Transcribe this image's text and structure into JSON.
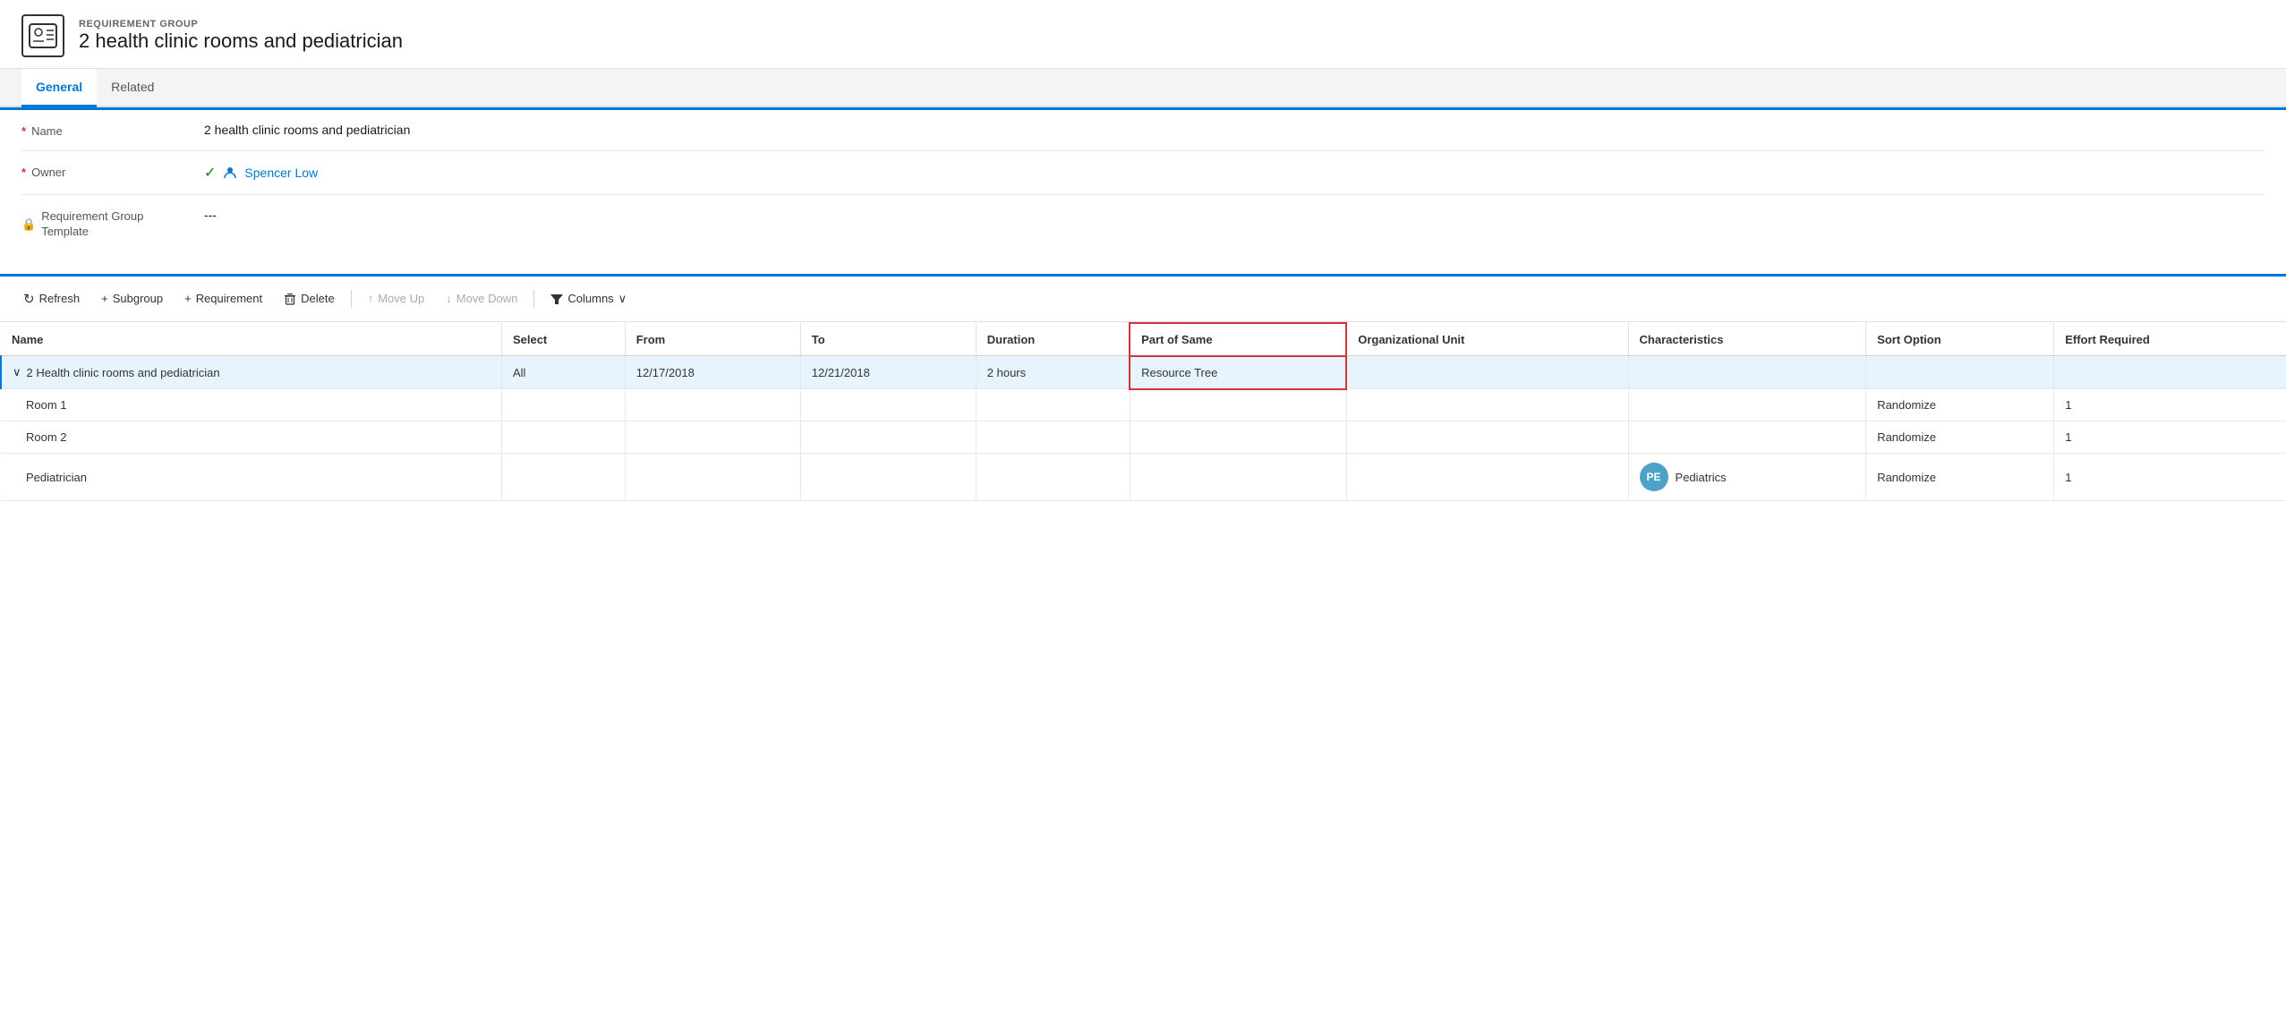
{
  "header": {
    "entity_type": "REQUIREMENT GROUP",
    "title": "2 health clinic rooms and pediatrician"
  },
  "tabs": [
    {
      "id": "general",
      "label": "General",
      "active": true
    },
    {
      "id": "related",
      "label": "Related",
      "active": false
    }
  ],
  "form": {
    "fields": [
      {
        "id": "name",
        "label": "Name",
        "required": true,
        "value": "2 health clinic rooms and pediatrician",
        "type": "text"
      },
      {
        "id": "owner",
        "label": "Owner",
        "required": true,
        "value": "Spencer Low",
        "type": "owner"
      },
      {
        "id": "requirement_group_template",
        "label": "Requirement Group Template",
        "required": false,
        "value": "---",
        "type": "text",
        "has_lock": true
      }
    ]
  },
  "toolbar": {
    "buttons": [
      {
        "id": "refresh",
        "label": "Refresh",
        "icon": "↻",
        "disabled": false
      },
      {
        "id": "subgroup",
        "label": "Subgroup",
        "icon": "+",
        "disabled": false
      },
      {
        "id": "requirement",
        "label": "Requirement",
        "icon": "+",
        "disabled": false
      },
      {
        "id": "delete",
        "label": "Delete",
        "icon": "🗑",
        "disabled": false
      },
      {
        "id": "move_up",
        "label": "Move Up",
        "icon": "↑",
        "disabled": true
      },
      {
        "id": "move_down",
        "label": "Move Down",
        "icon": "↓",
        "disabled": true
      },
      {
        "id": "columns",
        "label": "Columns",
        "icon": "▽",
        "disabled": false
      }
    ]
  },
  "table": {
    "columns": [
      {
        "id": "name",
        "label": "Name"
      },
      {
        "id": "select",
        "label": "Select"
      },
      {
        "id": "from",
        "label": "From"
      },
      {
        "id": "to",
        "label": "To"
      },
      {
        "id": "duration",
        "label": "Duration"
      },
      {
        "id": "part_of_same",
        "label": "Part of Same",
        "highlighted": true
      },
      {
        "id": "org_unit",
        "label": "Organizational Unit"
      },
      {
        "id": "characteristics",
        "label": "Characteristics"
      },
      {
        "id": "sort_option",
        "label": "Sort Option"
      },
      {
        "id": "effort_required",
        "label": "Effort Required"
      }
    ],
    "rows": [
      {
        "id": "group_row",
        "name": "2 Health clinic rooms and pediatrician",
        "indent": 0,
        "expandable": true,
        "selected": true,
        "select": "All",
        "from": "12/17/2018",
        "to": "12/21/2018",
        "duration": "2 hours",
        "part_of_same": "Resource Tree",
        "org_unit": "",
        "characteristics": "",
        "sort_option": "",
        "effort_required": "",
        "badge": null
      },
      {
        "id": "room1",
        "name": "Room 1",
        "indent": 1,
        "expandable": false,
        "selected": false,
        "select": "",
        "from": "",
        "to": "",
        "duration": "",
        "part_of_same": "",
        "org_unit": "",
        "characteristics": "",
        "sort_option": "Randomize",
        "effort_required": "1",
        "badge": null
      },
      {
        "id": "room2",
        "name": "Room 2",
        "indent": 1,
        "expandable": false,
        "selected": false,
        "select": "",
        "from": "",
        "to": "",
        "duration": "",
        "part_of_same": "",
        "org_unit": "",
        "characteristics": "",
        "sort_option": "Randomize",
        "effort_required": "1",
        "badge": null
      },
      {
        "id": "pediatrician",
        "name": "Pediatrician",
        "indent": 1,
        "expandable": false,
        "selected": false,
        "select": "",
        "from": "",
        "to": "",
        "duration": "",
        "part_of_same": "",
        "org_unit": "",
        "characteristics": "Pediatrics",
        "sort_option": "Randomize",
        "effort_required": "1",
        "badge": "PE"
      }
    ]
  },
  "icons": {
    "entity": "👤",
    "chevron_down": "∨",
    "refresh": "↻",
    "delete": "⬜",
    "filter": "▽",
    "lock": "🔒",
    "person": "👤",
    "check": "✓"
  }
}
